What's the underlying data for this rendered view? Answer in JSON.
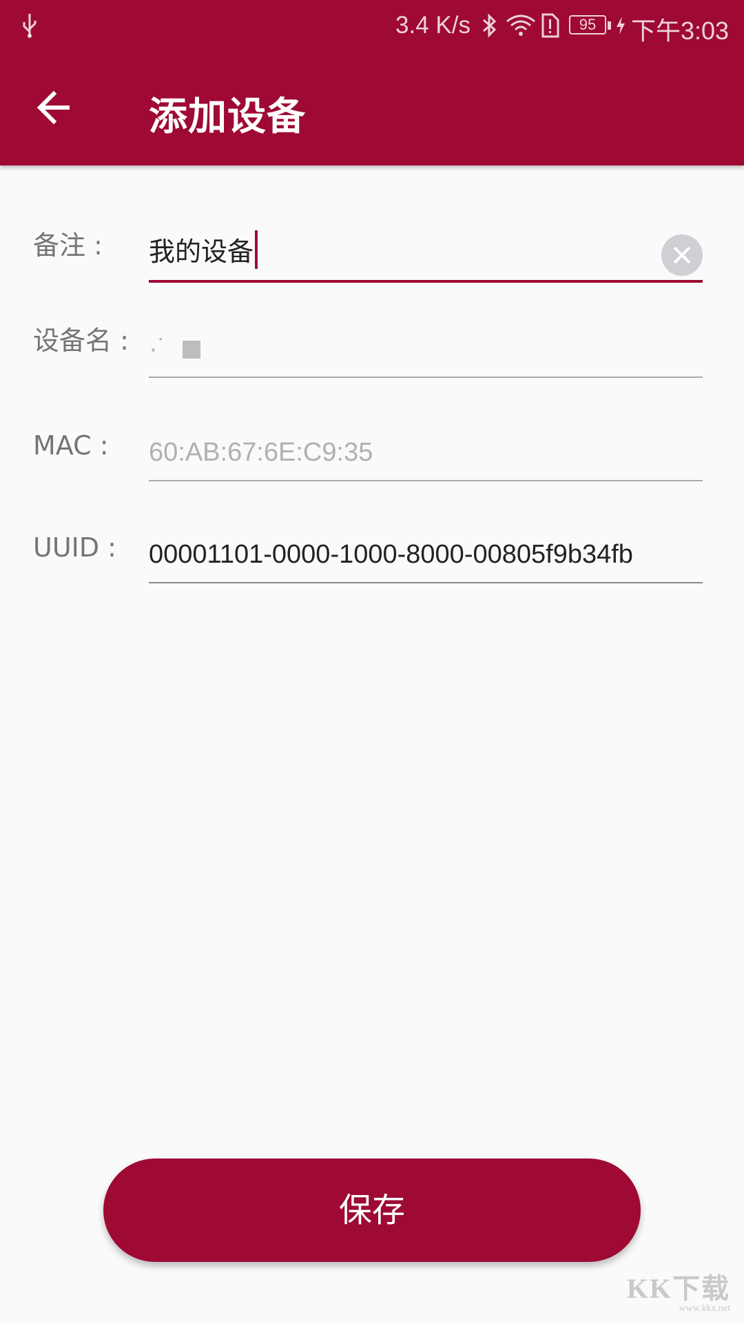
{
  "status_bar": {
    "network_speed": "3.4 K/s",
    "battery_level": "95",
    "time": "下午3:03",
    "icons": [
      "usb-icon",
      "bluetooth-icon",
      "wifi-icon",
      "sim-alert-icon",
      "battery-icon",
      "charging-icon"
    ]
  },
  "app_bar": {
    "title": "添加设备",
    "back_icon": "arrow-left-icon"
  },
  "form": {
    "remark": {
      "label": "备注 :",
      "value": "我的设备"
    },
    "device_name": {
      "label": "设备名 :",
      "value": "·˙"
    },
    "mac": {
      "label": "MAC :",
      "value": "60:AB:67:6E:C9:35"
    },
    "uuid": {
      "label": "UUID :",
      "value": "00001101-0000-1000-8000-00805f9b34fb"
    }
  },
  "save_button": {
    "label": "保存"
  },
  "watermark": {
    "logo": "KK下载",
    "url": "www.kkx.net"
  },
  "colors": {
    "primary": "#9e0a33",
    "background": "#fafafa",
    "label": "#757575",
    "hint": "#b0b0b0"
  }
}
